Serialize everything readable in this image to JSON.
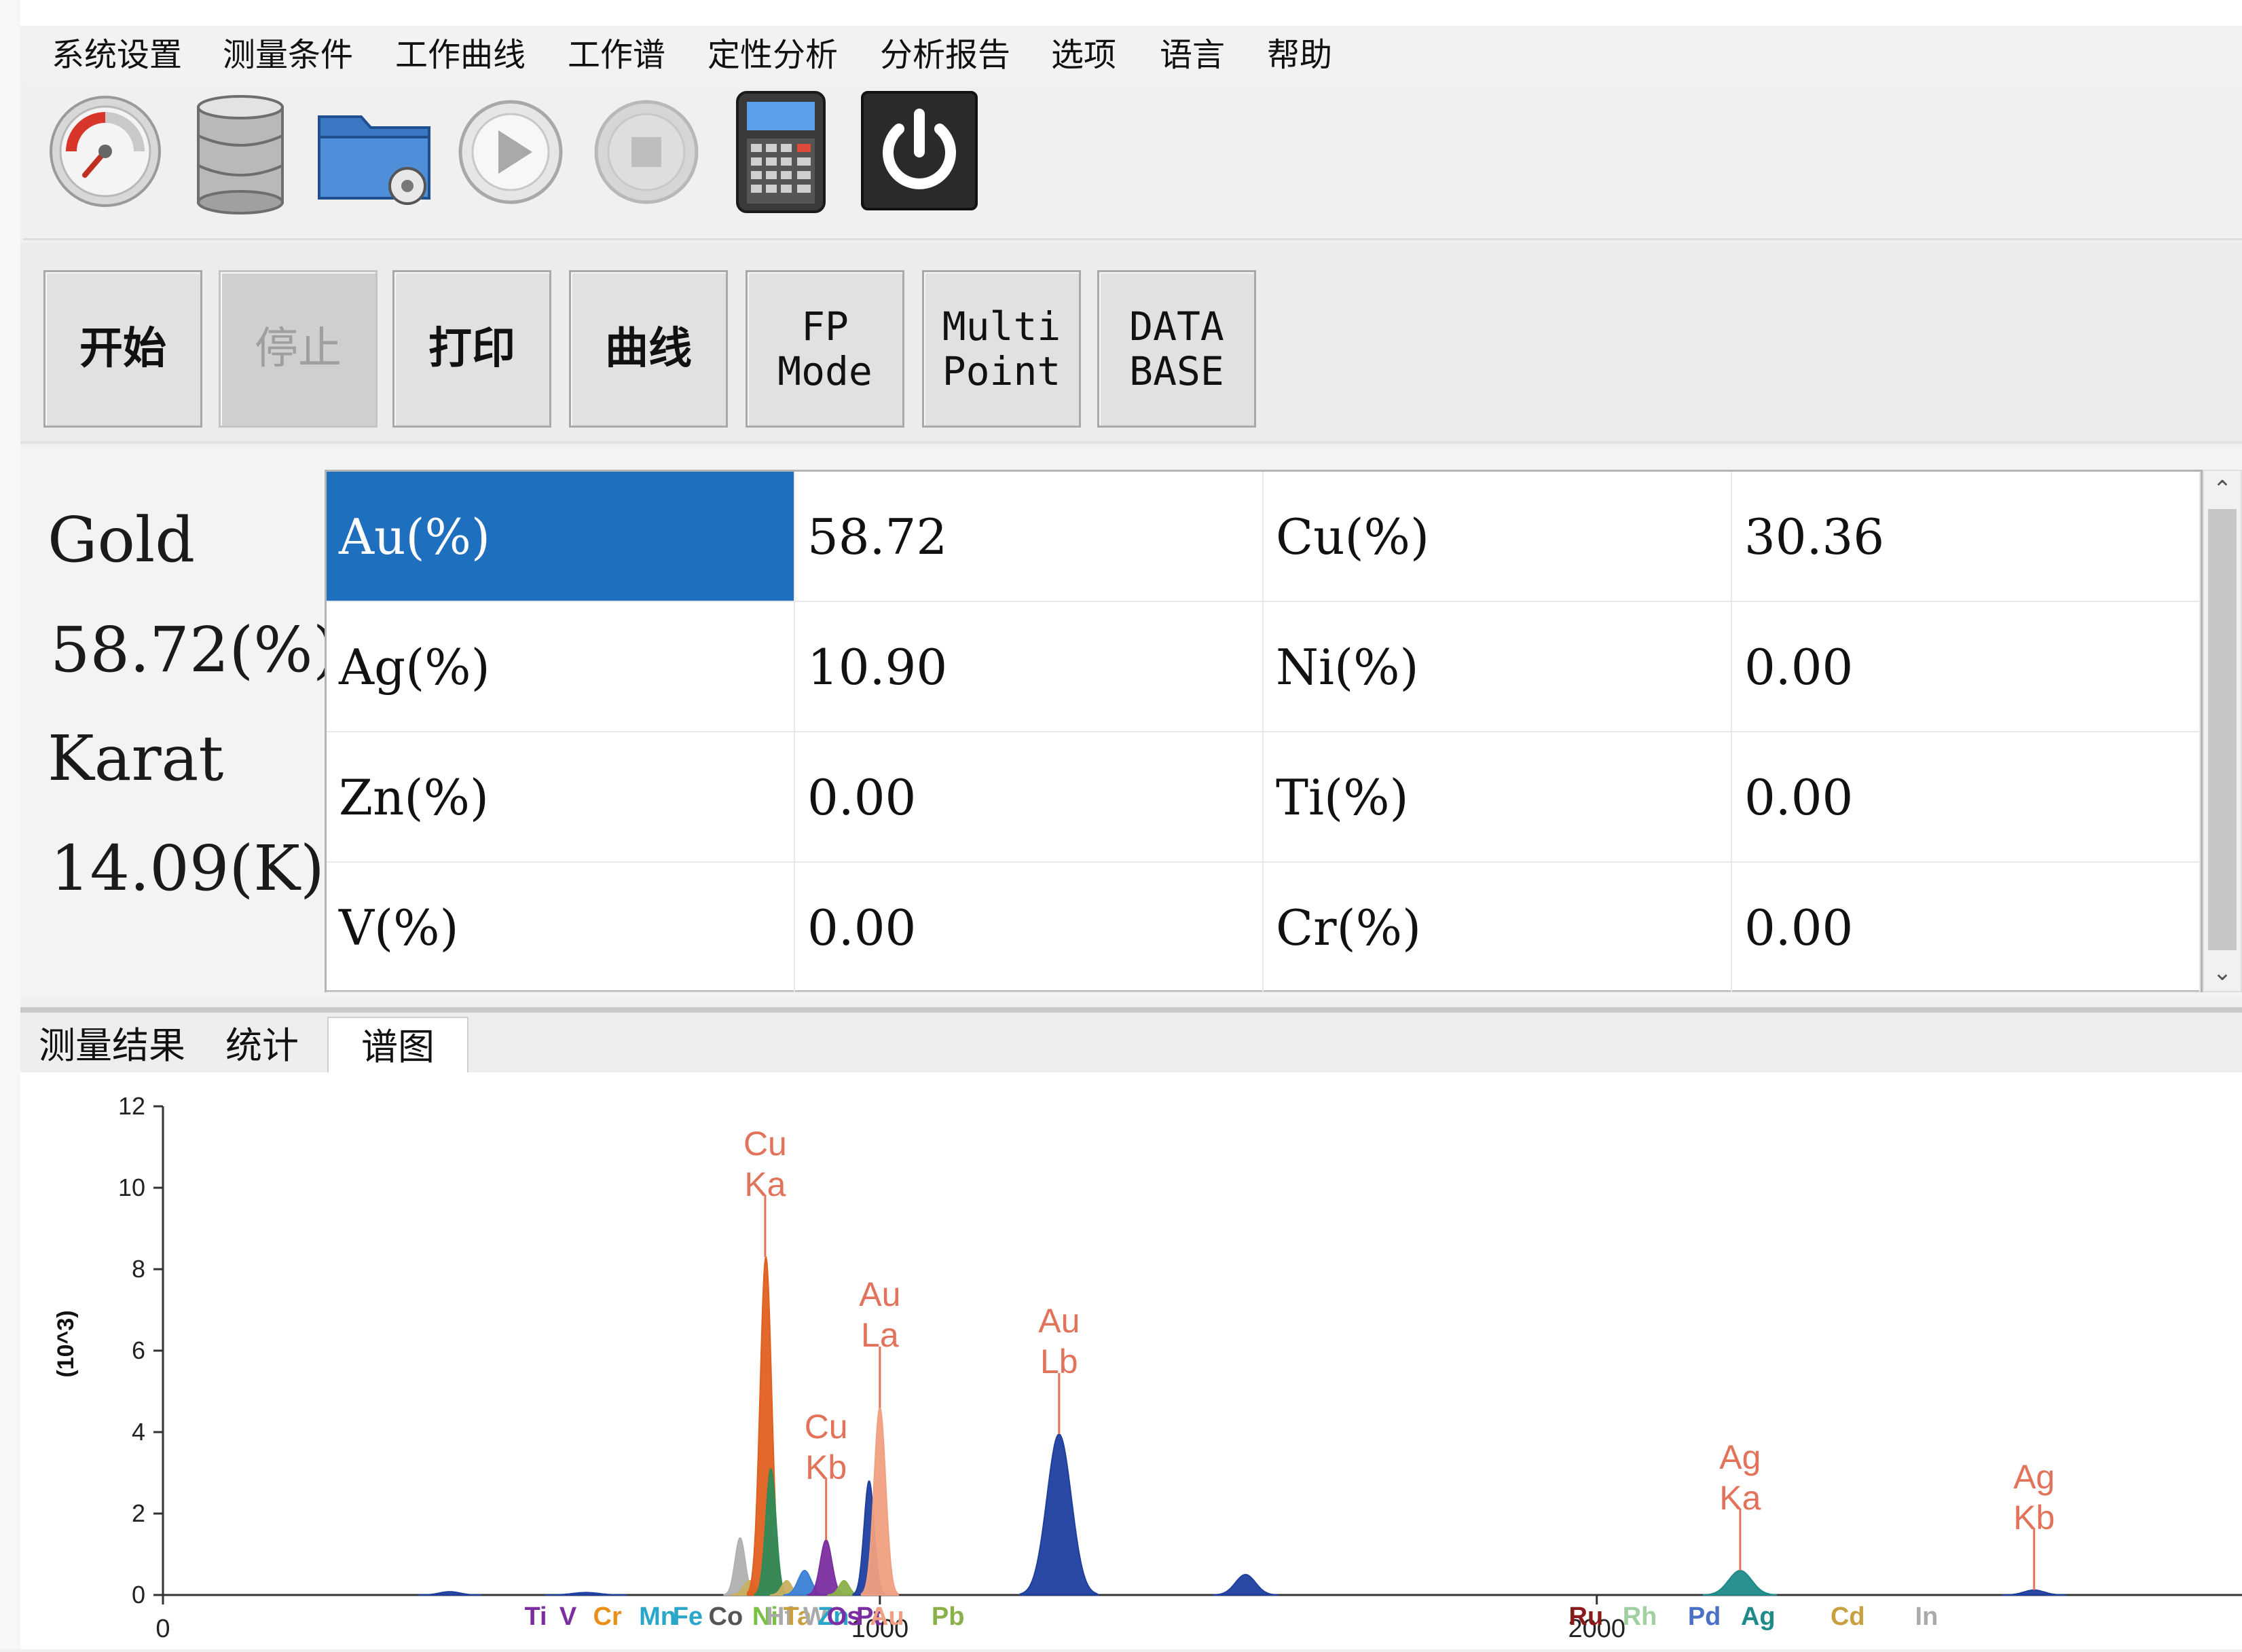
{
  "menu": [
    "系统设置",
    "测量条件",
    "工作曲线",
    "工作谱",
    "定性分析",
    "分析报告",
    "选项",
    "语言",
    "帮助"
  ],
  "toolbar": {
    "icons": [
      "speedometer-icon",
      "database-icon",
      "folder-settings-icon",
      "play-icon",
      "stop-icon",
      "calculator-icon",
      "power-icon"
    ]
  },
  "buttons": {
    "start": "开始",
    "stop": "停止",
    "print": "打印",
    "curve": "曲线",
    "fp_line1": "FP",
    "fp_line2": "Mode",
    "multi_line1": "Multi",
    "multi_line2": "Point",
    "db_line1": "DATA",
    "db_line2": "BASE"
  },
  "summary": {
    "element": "Gold",
    "percent": "58.72(%)",
    "karat_label": "Karat",
    "karat_value": "14.09(K)"
  },
  "results": {
    "rows": [
      {
        "el1": "Au(%)",
        "v1": "58.72",
        "el2": "Cu(%)",
        "v2": "30.36"
      },
      {
        "el1": "Ag(%)",
        "v1": "10.90",
        "el2": "Ni(%)",
        "v2": "0.00"
      },
      {
        "el1": "Zn(%)",
        "v1": "0.00",
        "el2": "Ti(%)",
        "v2": "0.00"
      },
      {
        "el1": "V(%)",
        "v1": "0.00",
        "el2": "Cr(%)",
        "v2": "0.00"
      }
    ]
  },
  "tabs": [
    "测量结果",
    "统计",
    "谱图"
  ],
  "chart_data": {
    "type": "area",
    "ylabel": "(10^3)",
    "xlabel": "",
    "xlim": [
      0,
      2900
    ],
    "ylim": [
      0,
      12
    ],
    "x_ticks": [
      0,
      1000,
      2000
    ],
    "y_ticks": [
      0,
      2,
      4,
      6,
      8,
      10,
      12
    ],
    "peaks": [
      {
        "x": 400,
        "y": 0.08,
        "w": 14,
        "color": "#1f3f9f"
      },
      {
        "x": 590,
        "y": 0.06,
        "w": 18,
        "color": "#1f3f9f"
      },
      {
        "x": 805,
        "y": 1.4,
        "w": 7,
        "color": "#b0b0b0"
      },
      {
        "x": 818,
        "y": 0.35,
        "w": 8,
        "color": "#c8b060"
      },
      {
        "x": 841,
        "y": 8.3,
        "w": 8,
        "color": "#e06020"
      },
      {
        "x": 848,
        "y": 3.1,
        "w": 7,
        "color": "#2e8b57"
      },
      {
        "x": 870,
        "y": 0.35,
        "w": 7,
        "color": "#c8b060"
      },
      {
        "x": 895,
        "y": 0.6,
        "w": 9,
        "color": "#3a7fd5"
      },
      {
        "x": 925,
        "y": 1.35,
        "w": 8,
        "color": "#7b2ea0"
      },
      {
        "x": 950,
        "y": 0.35,
        "w": 7,
        "color": "#8ab04a"
      },
      {
        "x": 985,
        "y": 2.8,
        "w": 7,
        "color": "#1f3f9f"
      },
      {
        "x": 1000,
        "y": 4.6,
        "w": 8,
        "color": "#f0a080"
      },
      {
        "x": 1250,
        "y": 3.95,
        "w": 17,
        "color": "#1f3f9f"
      },
      {
        "x": 1510,
        "y": 0.5,
        "w": 14,
        "color": "#1f3f9f"
      },
      {
        "x": 2200,
        "y": 0.6,
        "w": 16,
        "color": "#1f8a8a"
      },
      {
        "x": 2610,
        "y": 0.12,
        "w": 14,
        "color": "#1f3f9f"
      }
    ],
    "peak_labels": [
      {
        "x": 840,
        "line1": "Cu",
        "line2": "Ka",
        "y": 8.3
      },
      {
        "x": 925,
        "line1": "Cu",
        "line2": "Kb",
        "y": 1.35
      },
      {
        "x": 1000,
        "line1": "Au",
        "line2": "La",
        "y": 4.6
      },
      {
        "x": 1250,
        "line1": "Au",
        "line2": "Lb",
        "y": 3.95
      },
      {
        "x": 2200,
        "line1": "Ag",
        "line2": "Ka",
        "y": 0.6
      },
      {
        "x": 2610,
        "line1": "Ag",
        "line2": "Kb",
        "y": 0.12
      }
    ],
    "element_markers": [
      {
        "x": 520,
        "label": "Ti",
        "color": "#7b2ea0"
      },
      {
        "x": 565,
        "label": "V",
        "color": "#7b2ea0"
      },
      {
        "x": 620,
        "label": "Cr",
        "color": "#e8901a"
      },
      {
        "x": 690,
        "label": "Mn",
        "color": "#2aa6c8"
      },
      {
        "x": 732,
        "label": "Fe",
        "color": "#2aa6c8"
      },
      {
        "x": 785,
        "label": "Co",
        "color": "#555555"
      },
      {
        "x": 840,
        "label": "Ni",
        "color": "#7ac142"
      },
      {
        "x": 860,
        "label": "Hf",
        "color": "#aaaaaa"
      },
      {
        "x": 885,
        "label": "Ta",
        "color": "#c8a040"
      },
      {
        "x": 910,
        "label": "W",
        "color": "#aaaaaa"
      },
      {
        "x": 935,
        "label": "Zn",
        "color": "#2aa6c8"
      },
      {
        "x": 950,
        "label": "Os",
        "color": "#7b2ea0"
      },
      {
        "x": 985,
        "label": "Pt",
        "color": "#7b2ea0"
      },
      {
        "x": 1010,
        "label": "Au",
        "color": "#f0a080"
      },
      {
        "x": 1095,
        "label": "Pb",
        "color": "#8ab04a"
      },
      {
        "x": 1985,
        "label": "Ru",
        "color": "#8b1a1a"
      },
      {
        "x": 2060,
        "label": "Rh",
        "color": "#a0d0a0"
      },
      {
        "x": 2150,
        "label": "Pd",
        "color": "#4a70c8"
      },
      {
        "x": 2225,
        "label": "Ag",
        "color": "#1f8a8a"
      },
      {
        "x": 2350,
        "label": "Cd",
        "color": "#c8a040"
      },
      {
        "x": 2460,
        "label": "In",
        "color": "#aaaaaa"
      }
    ]
  }
}
